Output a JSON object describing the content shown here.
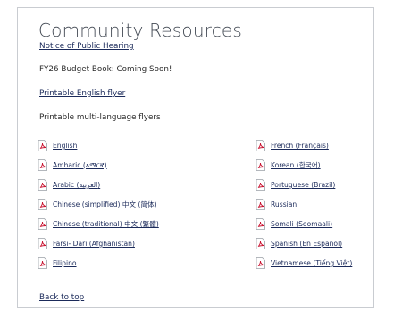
{
  "section": {
    "title": "Community Resources"
  },
  "links": {
    "notice": "Notice of Public Hearing",
    "budget_text": "FY26 Budget Book: Coming Soon!",
    "english_flyer": "Printable English flyer",
    "multi_heading": "Printable multi-language flyers",
    "back_to_top": "Back to top"
  },
  "flyers_left": [
    {
      "label": "English",
      "icon": "pdf-icon"
    },
    {
      "label": "Amharic (ኣማርኛ)",
      "icon": "pdf-icon"
    },
    {
      "label": "Arabic (العربية)",
      "icon": "pdf-icon"
    },
    {
      "label": "Chinese (simplified) 中文 (简体)",
      "icon": "pdf-icon"
    },
    {
      "label": "Chinese (traditional) 中文 (繁體)",
      "icon": "pdf-icon"
    },
    {
      "label": "Farsi- Dari (Afghanistan)",
      "icon": "pdf-icon"
    },
    {
      "label": "Filipino",
      "icon": "pdf-icon"
    }
  ],
  "flyers_right": [
    {
      "label": "French (Français)",
      "icon": "pdf-icon"
    },
    {
      "label": "Korean (한국어)",
      "icon": "pdf-icon"
    },
    {
      "label": "Portuguese (Brazil)",
      "icon": "pdf-icon"
    },
    {
      "label": "Russian",
      "icon": "pdf-icon"
    },
    {
      "label": "Somali (Soomaali)",
      "icon": "pdf-icon"
    },
    {
      "label": "Spanish (En Español)",
      "icon": "pdf-icon"
    },
    {
      "label": "Vietnamese (Tiếng Việt)",
      "icon": "pdf-icon"
    }
  ],
  "colors": {
    "link": "#1b2a5a",
    "title": "#434a54",
    "border": "#c9ccd1",
    "pdf_icon": "#c8102e"
  }
}
